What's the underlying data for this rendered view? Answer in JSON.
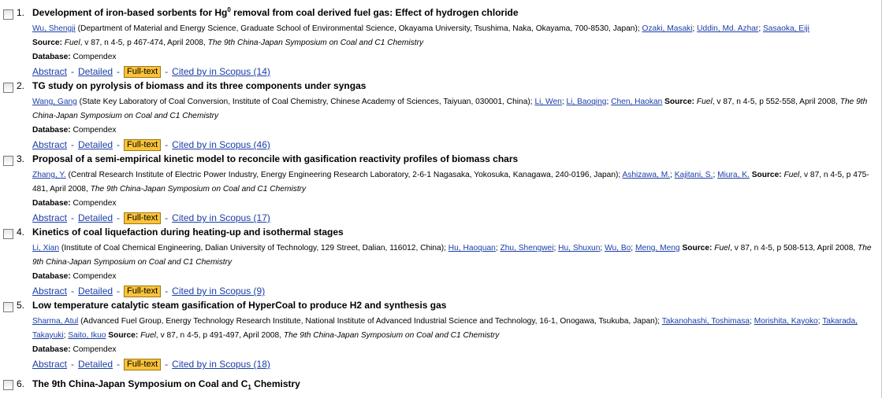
{
  "results": [
    {
      "num": "1.",
      "title_a": "Development of iron-based sorbents for Hg",
      "title_sup": "0",
      "title_b": " removal from coal derived fuel gas: Effect of hydrogen chloride",
      "authors": [
        {
          "name": "Wu, Shengji",
          "aff": " (Department of Material and Energy Science, Graduate School of Environmental Science, Okayama University, Tsushima, Naka, Okayama, 700-8530, Japan)",
          "sep": "; "
        },
        {
          "name": "Ozaki, Masaki",
          "aff": "",
          "sep": "; "
        },
        {
          "name": "Uddin, Md. Azhar",
          "aff": "",
          "sep": "; "
        },
        {
          "name": "Sasaoka, Eiji",
          "aff": "",
          "sep": ""
        }
      ],
      "source_journal": "Fuel",
      "source_rest": ", v 87, n 4-5, p 467-474, April 2008, ",
      "source_conf": "The 9th China-Japan Symposium on Coal and C1 Chemistry",
      "source_newline": true,
      "database": "Compendex",
      "cited": "Cited by in Scopus (14)"
    },
    {
      "num": "2.",
      "title_a": "TG study on pyrolysis of biomass and its three components under syngas",
      "title_sup": "",
      "title_b": "",
      "authors": [
        {
          "name": "Wang, Gang",
          "aff": " (State Key Laboratory of Coal Conversion, Institute of Coal Chemistry, Chinese Academy of Sciences, Taiyuan, 030001, China)",
          "sep": "; "
        },
        {
          "name": "Li, Wen",
          "aff": "",
          "sep": "; "
        },
        {
          "name": "Li, Baoqing",
          "aff": "",
          "sep": "; "
        },
        {
          "name": "Chen, Haokan",
          "aff": "",
          "sep": " "
        }
      ],
      "source_journal": "Fuel",
      "source_rest": ", v 87, n 4-5, p 552-558, April 2008, ",
      "source_conf": "The 9th China-Japan Symposium on Coal and C1 Chemistry",
      "source_newline": false,
      "database": "Compendex",
      "cited": "Cited by in Scopus (46)"
    },
    {
      "num": "3.",
      "title_a": "Proposal of a semi-empirical kinetic model to reconcile with gasification reactivity profiles of biomass chars",
      "title_sup": "",
      "title_b": "",
      "authors": [
        {
          "name": "Zhang, Y.",
          "aff": " (Central Research Institute of Electric Power Industry, Energy Engineering Research Laboratory, 2-6-1 Nagasaka, Yokosuka, Kanagawa, 240-0196, Japan)",
          "sep": "; "
        },
        {
          "name": "Ashizawa, M.",
          "aff": "",
          "sep": "; "
        },
        {
          "name": "Kajitani, S.",
          "aff": "",
          "sep": "; "
        },
        {
          "name": "Miura, K.",
          "aff": "",
          "sep": " "
        }
      ],
      "source_journal": "Fuel",
      "source_rest": ", v 87, n 4-5, p 475-481, April 2008, ",
      "source_conf": "The 9th China-Japan Symposium on Coal and C1 Chemistry",
      "source_newline": false,
      "database": "Compendex",
      "cited": "Cited by in Scopus (17)"
    },
    {
      "num": "4.",
      "title_a": "Kinetics of coal liquefaction during heating-up and isothermal stages",
      "title_sup": "",
      "title_b": "",
      "authors": [
        {
          "name": "Li, Xian",
          "aff": " (Institute of Coal Chemical Engineering, Dalian University of Technology, 129 Street, Dalian, 116012, China)",
          "sep": "; "
        },
        {
          "name": "Hu, Haoquan",
          "aff": "",
          "sep": "; "
        },
        {
          "name": "Zhu, Shengwei",
          "aff": "",
          "sep": "; "
        },
        {
          "name": "Hu, Shuxun",
          "aff": "",
          "sep": "; "
        },
        {
          "name": "Wu, Bo",
          "aff": "",
          "sep": "; "
        },
        {
          "name": "Meng, Meng",
          "aff": "",
          "sep": " "
        }
      ],
      "source_journal": "Fuel",
      "source_rest": ", v 87, n 4-5, p 508-513, April 2008, ",
      "source_conf": "The 9th China-Japan Symposium on Coal and C1 Chemistry",
      "source_newline": false,
      "database": "Compendex",
      "cited": "Cited by in Scopus (9)"
    },
    {
      "num": "5.",
      "title_a": "Low temperature catalytic steam gasification of HyperCoal to produce H2 and synthesis gas",
      "title_sup": "",
      "title_b": "",
      "authors": [
        {
          "name": "Sharma, Atul",
          "aff": " (Advanced Fuel Group, Energy Technology Research Institute, National Institute of Advanced Industrial Science and Technology, 16-1, Onogawa, Tsukuba, Japan)",
          "sep": "; "
        },
        {
          "name": "Takanohashi, Toshimasa",
          "aff": "",
          "sep": "; "
        },
        {
          "name": "Morishita, Kayoko",
          "aff": "",
          "sep": "; "
        },
        {
          "name": "Takarada, Takayuki",
          "aff": "",
          "sep": "; "
        },
        {
          "name": "Saito, Ikuo",
          "aff": "",
          "sep": " "
        }
      ],
      "source_journal": "Fuel",
      "source_rest": ", v 87, n 4-5, p 491-497, April 2008, ",
      "source_conf": "The 9th China-Japan Symposium on Coal and C1 Chemistry",
      "source_newline": false,
      "database": "Compendex",
      "cited": "Cited by in Scopus (18)"
    }
  ],
  "last_result": {
    "num": "6.",
    "title_a": "The 9th China-Japan Symposium on Coal and C",
    "title_sub": "1",
    "title_b": " Chemistry"
  },
  "labels": {
    "source": "Source:",
    "database": "Database:",
    "abstract": "Abstract",
    "detailed": "Detailed",
    "fulltext": "Full-text",
    "dash": "-"
  },
  "colors": {
    "link": "#1a3ea8",
    "fulltext_bg": "#fbc33a"
  }
}
